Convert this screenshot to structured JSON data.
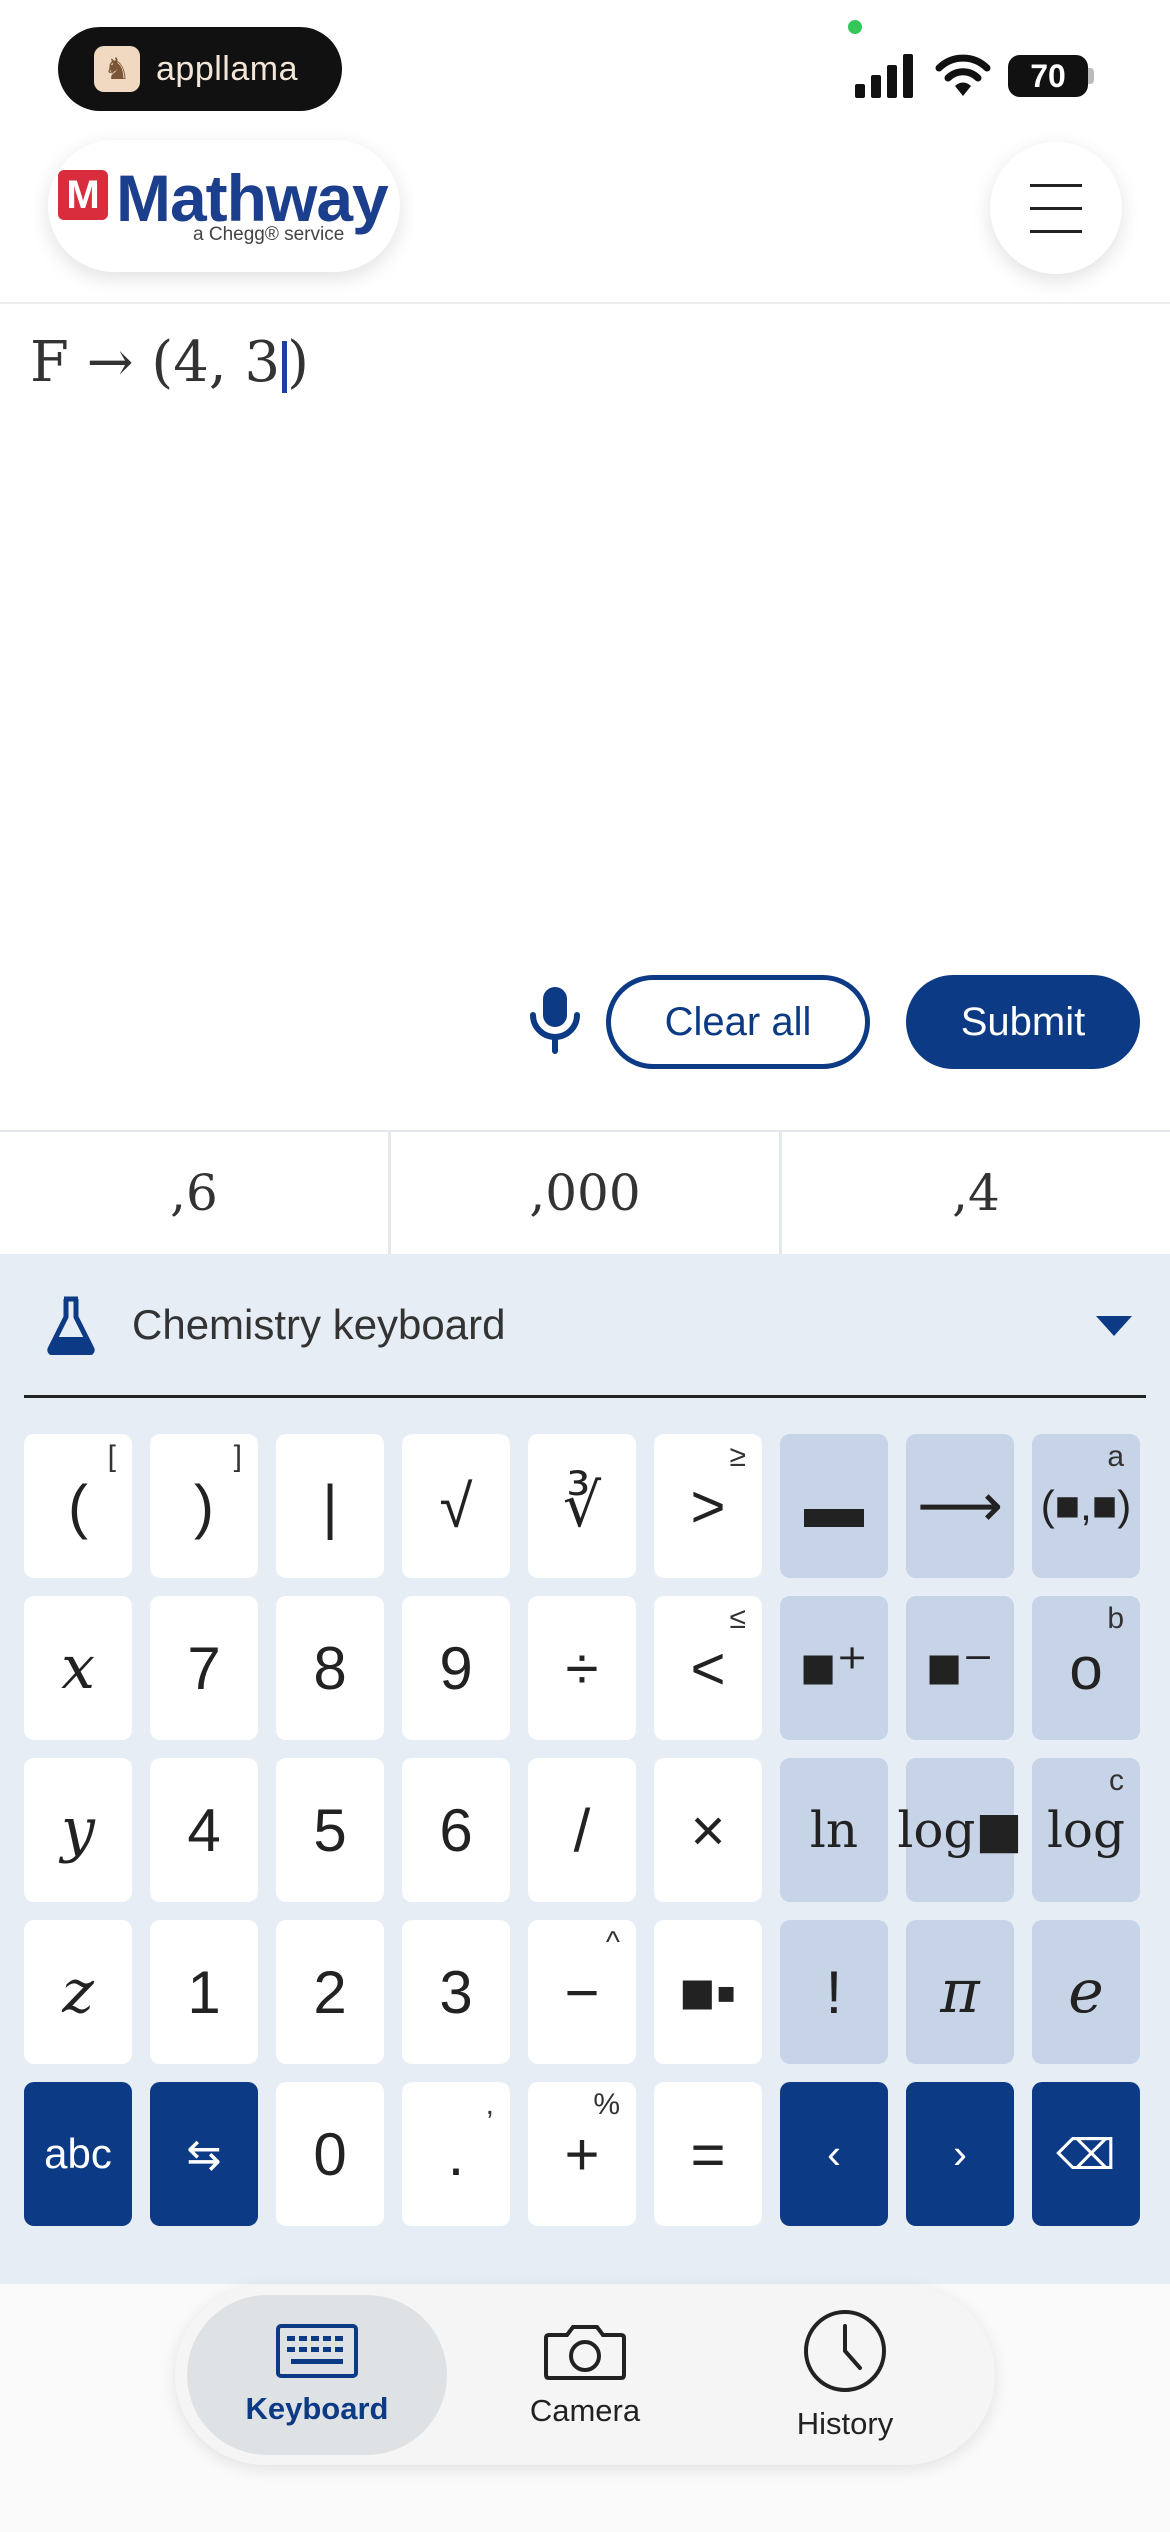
{
  "status_bar": {
    "app_pill_label": "appllama",
    "battery": "70"
  },
  "header": {
    "logo_letter": "M",
    "logo_word": "Mathway",
    "logo_subtitle": "a Chegg® service"
  },
  "expression": {
    "text": "F → (4, 3"
  },
  "actions": {
    "clear_label": "Clear all",
    "submit_label": "Submit"
  },
  "suggestions": [
    ",6",
    ",000",
    ",4"
  ],
  "keyboard": {
    "selector_label": "Chemistry keyboard",
    "rows": [
      [
        {
          "label": "(",
          "sup": "["
        },
        {
          "label": ")",
          "sup": "]"
        },
        {
          "label": "|"
        },
        {
          "label": "√"
        },
        {
          "label": "∛"
        },
        {
          "label": ">",
          "sup": "≥"
        },
        {
          "label": "▬",
          "ops": true
        },
        {
          "label": "⟶",
          "ops": true
        },
        {
          "label": "(■,■)",
          "sup": "a",
          "ops": true
        }
      ],
      [
        {
          "label": "x",
          "math": true
        },
        {
          "label": "7"
        },
        {
          "label": "8"
        },
        {
          "label": "9"
        },
        {
          "label": "÷"
        },
        {
          "label": "<",
          "sup": "≤"
        },
        {
          "label": "■⁺",
          "ops": true
        },
        {
          "label": "■⁻",
          "ops": true
        },
        {
          "label": "o",
          "sup": "b",
          "ops": true
        }
      ],
      [
        {
          "label": "y",
          "math": true
        },
        {
          "label": "4"
        },
        {
          "label": "5"
        },
        {
          "label": "6"
        },
        {
          "label": "/"
        },
        {
          "label": "×"
        },
        {
          "label": "ln",
          "ops": true
        },
        {
          "label": "log■",
          "ops": true
        },
        {
          "label": "log",
          "sup": "c",
          "ops": true
        }
      ],
      [
        {
          "label": "z",
          "math": true
        },
        {
          "label": "1"
        },
        {
          "label": "2"
        },
        {
          "label": "3"
        },
        {
          "label": "−",
          "sup": "^"
        },
        {
          "label": "■▪"
        },
        {
          "label": "!",
          "ops": true
        },
        {
          "label": "π",
          "ops": true
        },
        {
          "label": "e",
          "ops": true
        }
      ],
      [
        {
          "label": "abc",
          "dark": true
        },
        {
          "label": "⇆",
          "dark": true
        },
        {
          "label": "0"
        },
        {
          "label": ".",
          "sup": ","
        },
        {
          "label": "+",
          "sup": "%"
        },
        {
          "label": "="
        },
        {
          "label": "‹",
          "dark": true
        },
        {
          "label": "›",
          "dark": true
        },
        {
          "label": "⌫",
          "dark": true
        }
      ]
    ]
  },
  "tabs": [
    {
      "label": "Keyboard",
      "icon": "keyboard-icon",
      "active": true
    },
    {
      "label": "Camera",
      "icon": "camera-icon",
      "active": false
    },
    {
      "label": "History",
      "icon": "history-icon",
      "active": false
    }
  ],
  "colors": {
    "brand": "#0c3a84",
    "keyboard_bg": "#e7edf5",
    "ops_key": "#c7d3e6",
    "logo_red": "#d92d3d"
  }
}
